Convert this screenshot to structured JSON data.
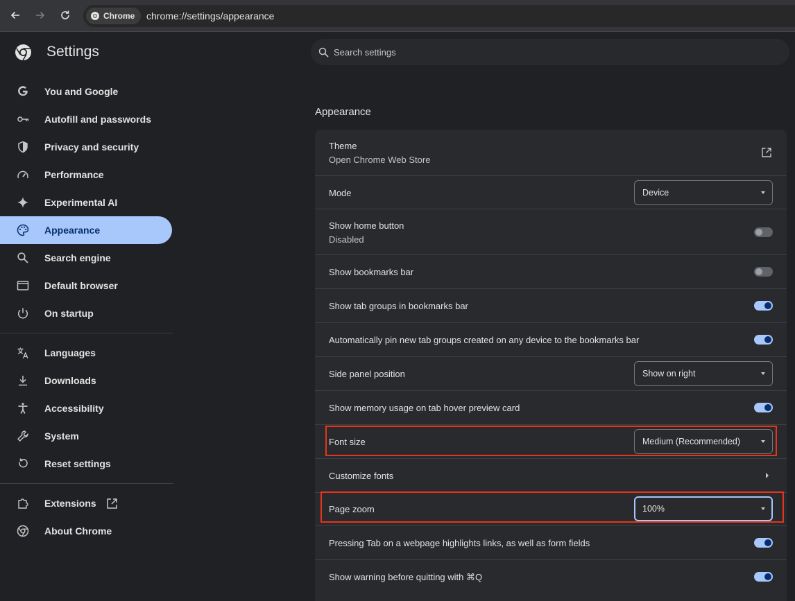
{
  "browser": {
    "chip_label": "Chrome",
    "url": "chrome://settings/appearance"
  },
  "sidebar": {
    "title": "Settings",
    "items": [
      {
        "label": "You and Google",
        "icon": "google-g-icon"
      },
      {
        "label": "Autofill and passwords",
        "icon": "key-icon"
      },
      {
        "label": "Privacy and security",
        "icon": "shield-icon"
      },
      {
        "label": "Performance",
        "icon": "speedometer-icon"
      },
      {
        "label": "Experimental AI",
        "icon": "sparkle-icon"
      },
      {
        "label": "Appearance",
        "icon": "palette-icon",
        "active": true
      },
      {
        "label": "Search engine",
        "icon": "search-icon"
      },
      {
        "label": "Default browser",
        "icon": "browser-window-icon"
      },
      {
        "label": "On startup",
        "icon": "power-icon"
      },
      {
        "label": "Languages",
        "icon": "translate-icon"
      },
      {
        "label": "Downloads",
        "icon": "download-icon"
      },
      {
        "label": "Accessibility",
        "icon": "accessibility-icon"
      },
      {
        "label": "System",
        "icon": "wrench-icon"
      },
      {
        "label": "Reset settings",
        "icon": "reset-icon"
      },
      {
        "label": "Extensions",
        "icon": "puzzle-icon"
      },
      {
        "label": "About Chrome",
        "icon": "chrome-logo-icon"
      }
    ]
  },
  "search": {
    "placeholder": "Search settings"
  },
  "main": {
    "section_title": "Appearance",
    "rows": {
      "theme": {
        "title": "Theme",
        "subtitle": "Open Chrome Web Store"
      },
      "mode": {
        "title": "Mode",
        "value": "Device"
      },
      "home_button": {
        "title": "Show home button",
        "subtitle": "Disabled",
        "enabled": false
      },
      "bookmarks_bar": {
        "title": "Show bookmarks bar",
        "enabled": false
      },
      "tab_groups": {
        "title": "Show tab groups in bookmarks bar",
        "enabled": true
      },
      "pin_tab_groups": {
        "title": "Automatically pin new tab groups created on any device to the bookmarks bar",
        "enabled": true
      },
      "side_panel": {
        "title": "Side panel position",
        "value": "Show on right"
      },
      "memory_usage": {
        "title": "Show memory usage on tab hover preview card",
        "enabled": true
      },
      "font_size": {
        "title": "Font size",
        "value": "Medium (Recommended)"
      },
      "customize_fonts": {
        "title": "Customize fonts"
      },
      "page_zoom": {
        "title": "Page zoom",
        "value": "100%"
      },
      "tab_highlights": {
        "title": "Pressing Tab on a webpage highlights links, as well as form fields",
        "enabled": true
      },
      "quit_warning": {
        "title": "Show warning before quitting with ⌘Q",
        "enabled": true
      }
    }
  },
  "colors": {
    "accent": "#a8c7fa",
    "highlight_box": "#e8341c"
  }
}
